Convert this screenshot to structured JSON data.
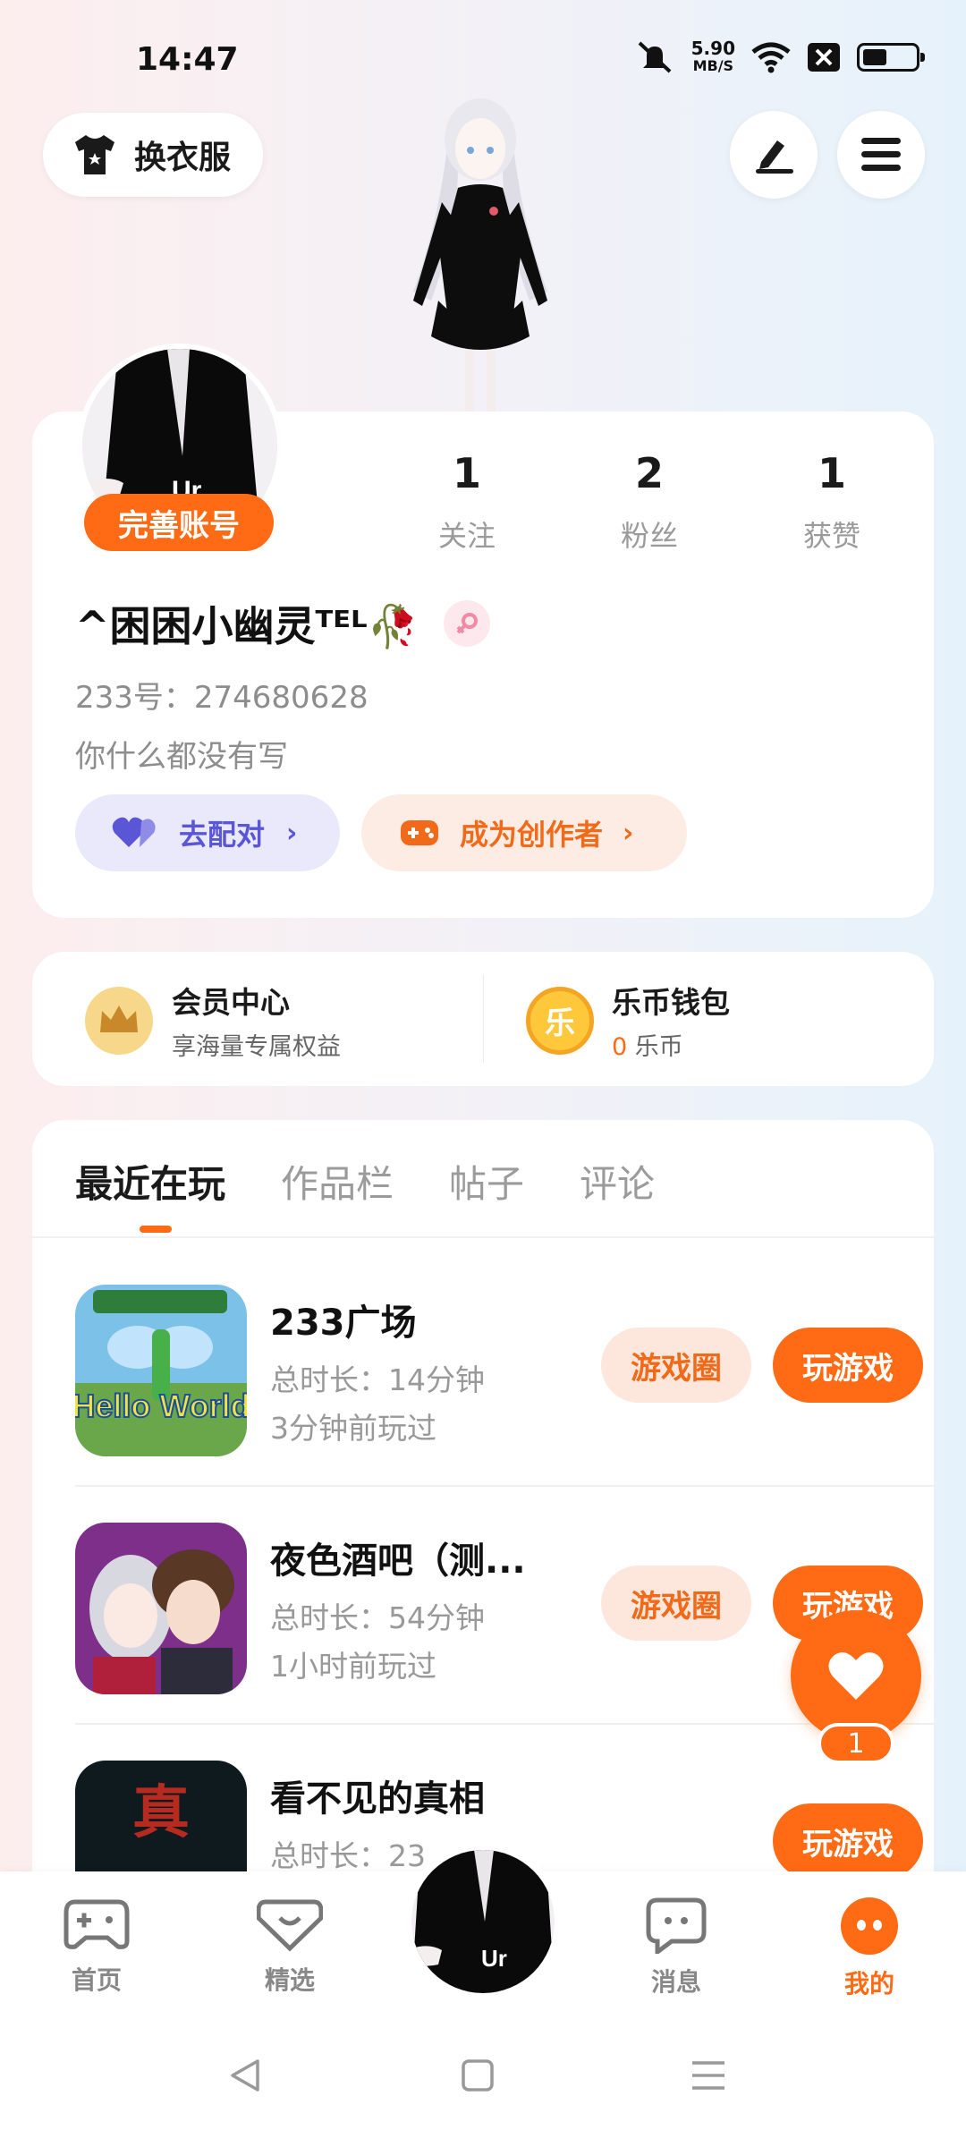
{
  "status_bar": {
    "time": "14:47",
    "speed_value": "5.90",
    "speed_unit": "MB/S"
  },
  "header": {
    "outfit_label": "换衣服"
  },
  "profile": {
    "complete_label": "完善账号",
    "stats": [
      {
        "value": "1",
        "label": "关注"
      },
      {
        "value": "2",
        "label": "粉丝"
      },
      {
        "value": "1",
        "label": "获赞"
      }
    ],
    "username": "^困困小幽灵ᵀᴱᴸ🥀",
    "uid": "233号：274680628",
    "bio": "你什么都没有写",
    "match_label": "去配对",
    "creator_label": "成为创作者"
  },
  "member": {
    "vip_title": "会员中心",
    "vip_sub": "享海量专属权益",
    "wallet_title": "乐币钱包",
    "wallet_balance": "0",
    "wallet_unit": "乐币",
    "coin_glyph": "乐"
  },
  "tabs": [
    "最近在玩",
    "作品栏",
    "帖子",
    "评论"
  ],
  "games": [
    {
      "title": "233广场",
      "duration": "总时长：14分钟",
      "last_played": "3分钟前玩过",
      "circle_label": "游戏圈",
      "play_label": "玩游戏",
      "thumb_text": "Hello World"
    },
    {
      "title": "夜色酒吧（测...",
      "duration": "总时长：54分钟",
      "last_played": "1小时前玩过",
      "circle_label": "游戏圈",
      "play_label": "玩游戏"
    },
    {
      "title": "看不见的真相",
      "duration": "总时长：23",
      "play_label": "玩游戏",
      "thumb_text": "真"
    }
  ],
  "like": {
    "count": "1"
  },
  "bottom_nav": {
    "home": "首页",
    "featured": "精选",
    "messages": "消息",
    "mine": "我的"
  },
  "colors": {
    "accent": "#ff6a14",
    "match": "#5a56d6"
  }
}
